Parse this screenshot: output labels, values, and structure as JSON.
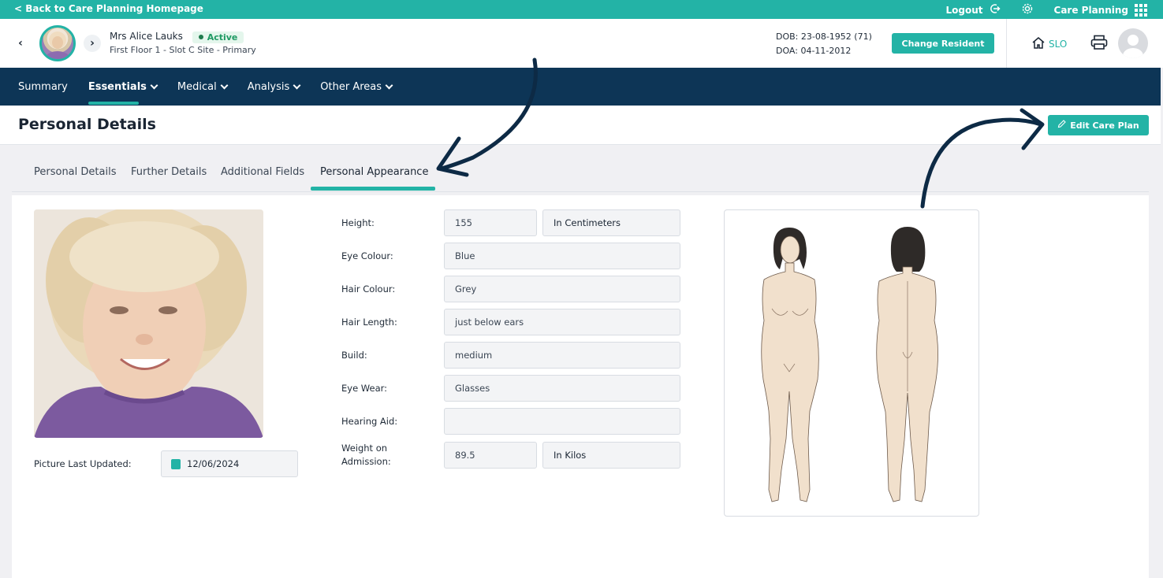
{
  "topbar": {
    "back_label": "< Back to Care Planning Homepage",
    "logout_label": "Logout",
    "app_label": "Care Planning"
  },
  "resident": {
    "name": "Mrs Alice Lauks",
    "status": "Active",
    "location": "First Floor 1 - Slot C Site - Primary",
    "dob": "DOB: 23-08-1952 (71)",
    "doa": "DOA: 04-11-2012",
    "change_label": "Change Resident",
    "home_label": "SLO"
  },
  "mainnav": {
    "items": [
      {
        "label": "Summary"
      },
      {
        "label": "Essentials"
      },
      {
        "label": "Medical"
      },
      {
        "label": "Analysis"
      },
      {
        "label": "Other Areas"
      }
    ]
  },
  "page": {
    "title": "Personal Details",
    "edit_label": "Edit Care Plan"
  },
  "tabs": [
    {
      "label": "Personal Details"
    },
    {
      "label": "Further Details"
    },
    {
      "label": "Additional Fields"
    },
    {
      "label": "Personal Appearance"
    }
  ],
  "picture": {
    "label": "Picture Last Updated:",
    "date": "12/06/2024"
  },
  "fields": {
    "height_label": "Height:",
    "height_value": "155",
    "height_unit": "In Centimeters",
    "eye_colour_label": "Eye Colour:",
    "eye_colour_value": "Blue",
    "hair_colour_label": "Hair Colour:",
    "hair_colour_value": "Grey",
    "hair_length_label": "Hair Length:",
    "hair_length_value": "just below ears",
    "build_label": "Build:",
    "build_value": "medium",
    "eye_wear_label": "Eye Wear:",
    "eye_wear_value": "Glasses",
    "hearing_aid_label": "Hearing Aid:",
    "hearing_aid_value": "",
    "weight_label_1": "Weight on",
    "weight_label_2": "Admission:",
    "weight_value": "89.5",
    "weight_unit": "In Kilos"
  },
  "colors": {
    "accent": "#23b3a6",
    "nav": "#0d3556",
    "annotation_arrow": "#0d2a45"
  }
}
